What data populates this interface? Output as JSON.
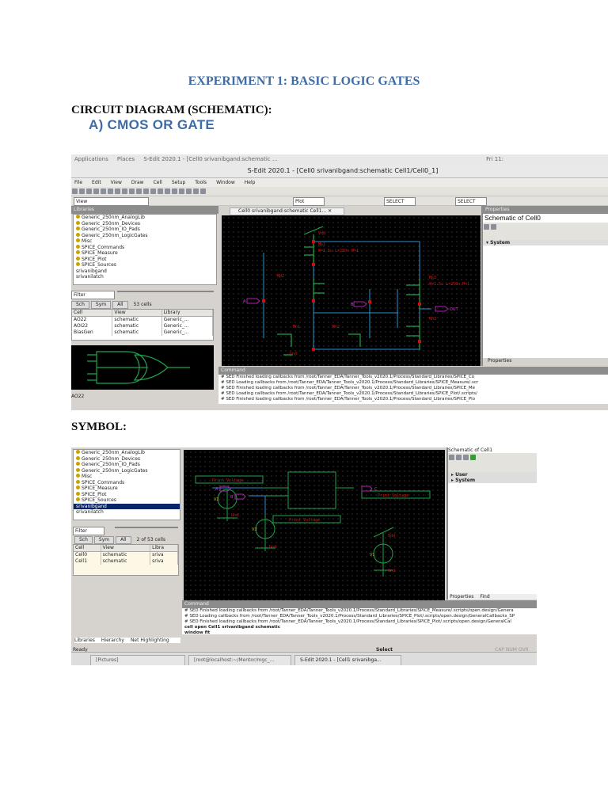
{
  "doc": {
    "title": "EXPERIMENT 1: BASIC LOGIC GATES",
    "section": "CIRCUIT DIAGRAM (SCHEMATIC):",
    "subsection": "A) CMOS OR GATE",
    "symbol_heading": "SYMBOL:"
  },
  "shot1": {
    "gnome": {
      "applications": "Applications",
      "places": "Places",
      "task": "S-Edit 2020.1 - [Cell0 srivanibgand:schematic ...",
      "clock": "Fri 11:"
    },
    "window_title": "S-Edit 2020.1 - [Cell0 srivanibgand:schematic Cell1/Cell0_1]",
    "menu": [
      "File",
      "Edit",
      "View",
      "Draw",
      "Cell",
      "Setup",
      "Tools",
      "Window",
      "Help"
    ],
    "view_combo": "View",
    "select_a": "SELECT",
    "select_b": "SELECT",
    "plot_combo": "Plot",
    "libraries_header": "Libraries",
    "libraries": [
      "Generic_250nm_AnalogLib",
      "Generic_250nm_Devices",
      "Generic_250nm_IO_Pads",
      "Generic_250nm_LogicGates",
      "Misc",
      "SPICE_Commands",
      "SPICE_Measure",
      "SPICE_Plot",
      "SPICE_Sources",
      "srivanibgand",
      "srivanilatch"
    ],
    "filter": "Filter",
    "tabs": [
      "Sch",
      "Sym",
      "All"
    ],
    "cell_count": "53 cells",
    "columns": [
      "Cell",
      "View",
      "Library"
    ],
    "rows": [
      [
        "AO22",
        "schematic",
        "Generic_..."
      ],
      [
        "AOI22",
        "schematic",
        "Generic_..."
      ],
      [
        "BiasGen",
        "schematic",
        "Generic_..."
      ]
    ],
    "preview_label": "AO22",
    "doc_tab": "Cell0 srivanibgand:schematic Cell1...",
    "properties_header": "Properties",
    "properties_title": "Schematic of Cell0",
    "properties_group": "System",
    "properties_tab": "Properties",
    "command_header": "Command",
    "command_lines": [
      "# SED     Finished loading callbacks from /root/Tanner_EDA/Tanner_Tools_v2020.1/Process/Standard_Libraries/SPICE_Co",
      "# SED   Loading callbacks from /root/Tanner_EDA/Tanner_Tools_v2020.1/Process/Standard_Libraries/SPICE_Measure/.scr",
      "# SED     Finished loading callbacks from /root/Tanner_EDA/Tanner_Tools_v2020.1/Process/Standard_Libraries/SPICE_Me",
      "# SED   Loading callbacks from /root/Tanner_EDA/Tanner_Tools_v2020.1/Process/Standard_Libraries/SPICE_Plot/.scripts/",
      "# SED     Finished loading callbacks from /root/Tanner_EDA/Tanner_Tools_v2020.1/Process/Standard_Libraries/SPICE_Plo"
    ],
    "schematic": {
      "vdd": "Vdd",
      "gnd": "Gnd",
      "in_a": "A",
      "in_b": "B",
      "out": "OUT",
      "mp1": "Mp1",
      "mp2": "Mp2",
      "mp3": "Mp3",
      "mn1": "Mn1",
      "mn2": "Mn2",
      "mn3": "Mn3",
      "params": "W=1.5u L=250n M=1"
    }
  },
  "shot2": {
    "libraries": [
      "Generic_250nm_AnalogLib",
      "Generic_250nm_Devices",
      "Generic_250nm_IO_Pads",
      "Generic_250nm_LogicGates",
      "Misc",
      "SPICE_Commands",
      "SPICE_Measure",
      "SPICE_Plot",
      "SPICE_Sources",
      "srivanibgand",
      "srivanilatch"
    ],
    "selected_library": "srivanibgand",
    "filter": "Filter",
    "tabs": [
      "Sch",
      "Sym",
      "All"
    ],
    "cell_count": "2 of 53 cells",
    "columns": [
      "Cell",
      "View",
      "Libra"
    ],
    "rows": [
      [
        "Cell0",
        "schematic",
        "sriva"
      ],
      [
        "Cell1",
        "schematic",
        "sriva"
      ]
    ],
    "bottom_tabs": [
      "Libraries",
      "Hierarchy",
      "Net Highlighting"
    ],
    "status_ready": "Ready",
    "status_select": "Select",
    "status_flags": [
      "CAP",
      "NUM",
      "OVR"
    ],
    "properties_title": "Schematic of Cell1",
    "properties_groups": [
      "User",
      "System"
    ],
    "properties_tabs": [
      "Properties",
      "Find"
    ],
    "command_header": "Command",
    "command_lines": [
      "# SED     Finished loading callbacks from /root/Tanner_EDA/Tanner_Tools_v2020.1/Process/Standard_Libraries/SPICE_Measure/.scripts/open.design/Genera",
      "# SED   Loading callbacks from /root/Tanner_EDA/Tanner_Tools_v2020.1/Process/Standard_Libraries/SPICE_Plot/.scripts/open.design/GeneralCallbacks_SP",
      "# SED     Finished loading callbacks from /root/Tanner_EDA/Tanner_Tools_v2020.1/Process/Standard_Libraries/SPICE_Plot/.scripts/open.design/GeneralCal"
    ],
    "command_bold": [
      "cell open Cell1 srivanibgand schematic",
      "window fit"
    ],
    "taskbar": [
      "[Pictures]",
      "[root@localhost:~/Mentor/mgc_...",
      "S-Edit 2020.1 - [Cell1 srivanibga..."
    ],
    "schematic": {
      "print_voltage": "Print Voltage",
      "a": "A",
      "b": "B",
      "c": "C",
      "v1": "V1",
      "v2": "V2",
      "v3": "V3",
      "gnd": "Gnd",
      "vdd": "Vdd"
    }
  }
}
